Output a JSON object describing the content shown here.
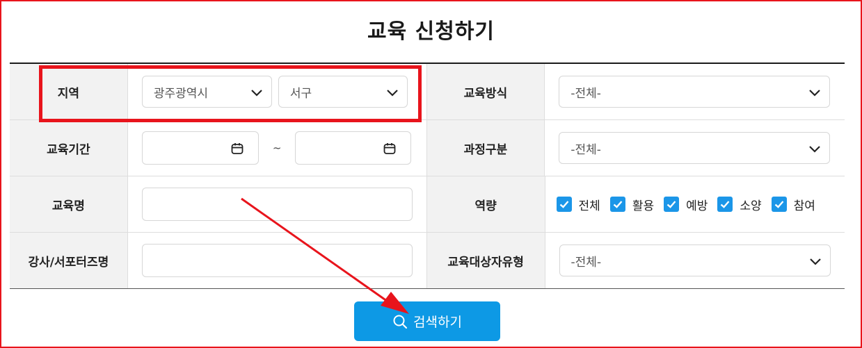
{
  "title": "교육 신청하기",
  "region": {
    "label": "지역",
    "city": "광주광역시",
    "district": "서구"
  },
  "method": {
    "label": "교육방식",
    "value": "-전체-"
  },
  "period": {
    "label": "교육기간",
    "separator": "~"
  },
  "category": {
    "label": "과정구분",
    "value": "-전체-"
  },
  "course_name": {
    "label": "교육명"
  },
  "competency": {
    "label": "역량",
    "options": [
      {
        "label": "전체",
        "checked": true
      },
      {
        "label": "활용",
        "checked": true
      },
      {
        "label": "예방",
        "checked": true
      },
      {
        "label": "소양",
        "checked": true
      },
      {
        "label": "참여",
        "checked": true
      }
    ]
  },
  "instructor": {
    "label": "강사/서포터즈명"
  },
  "target": {
    "label": "교육대상자유형",
    "value": "-전체-"
  },
  "search_button": {
    "label": "검색하기",
    "icon": "search-icon"
  },
  "colors": {
    "accent": "#0d99e5",
    "checkbox": "#1b96e8",
    "annotation": "#e8141c"
  }
}
